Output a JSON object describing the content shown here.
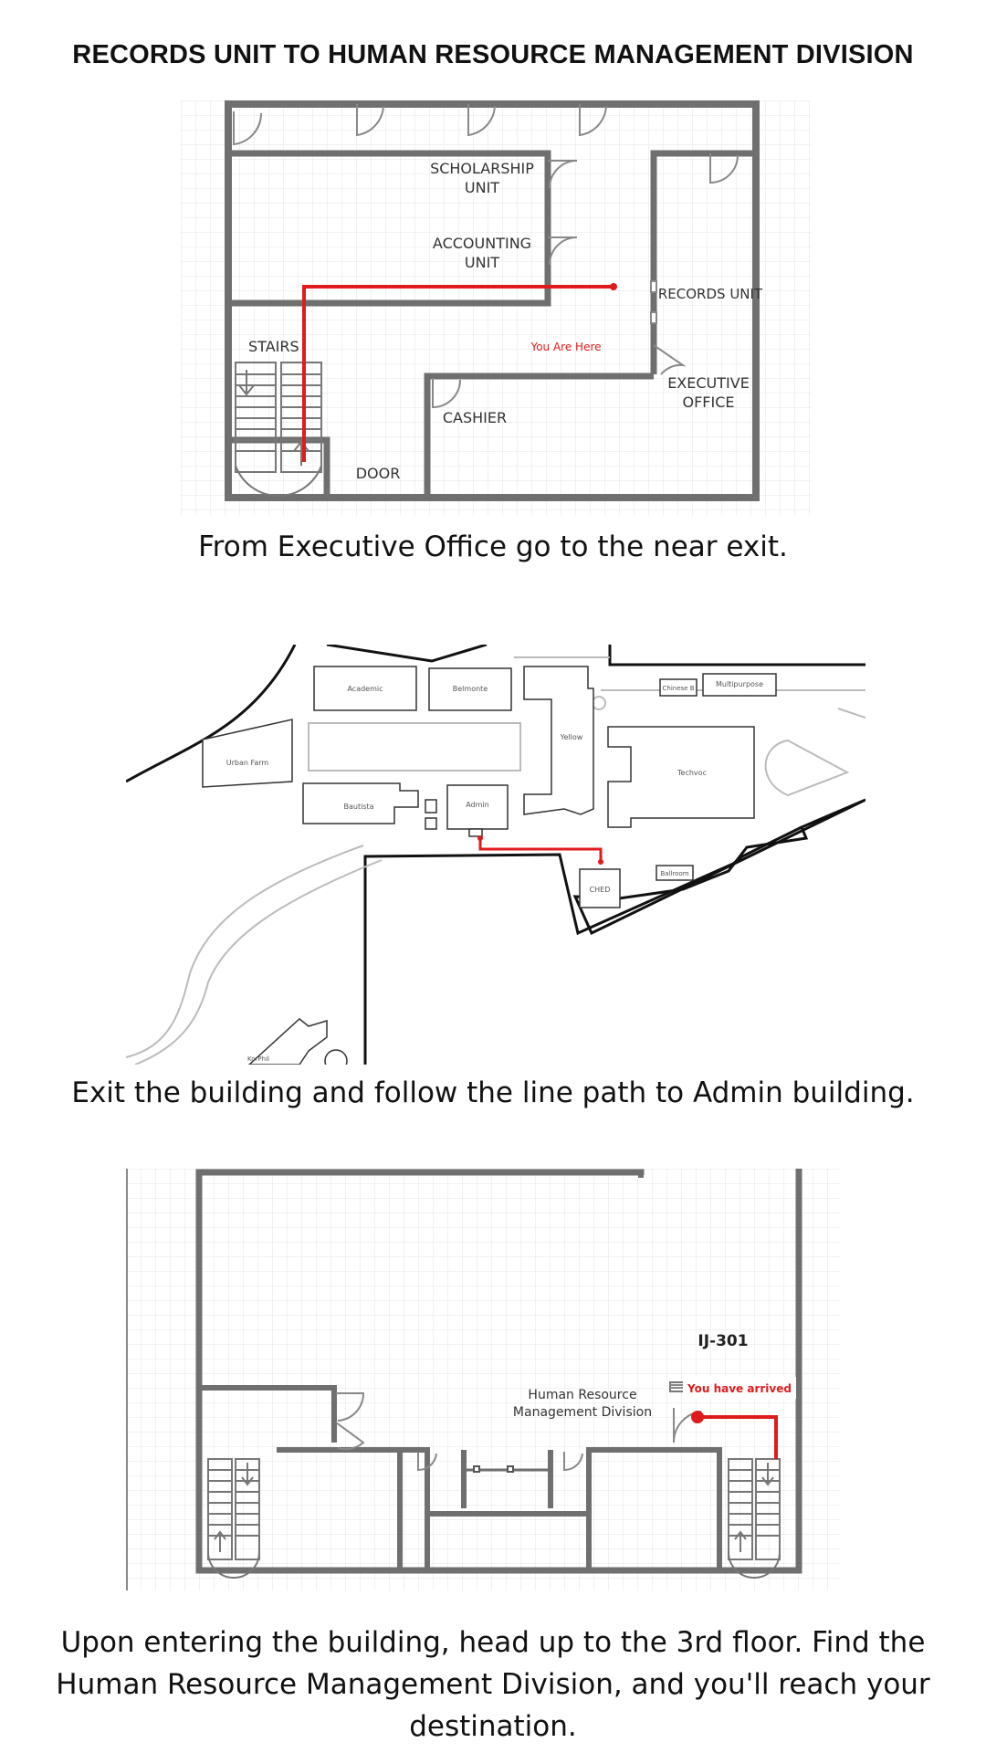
{
  "title": "RECORDS  UNIT TO  HUMAN RESOURCE MANAGEMENT DIVISION",
  "step1": {
    "caption": "From Executive Office  go to the near exit.",
    "labels": {
      "scholarship_1": "SCHOLARSHIP",
      "scholarship_2": "UNIT",
      "accounting_1": "ACCOUNTING",
      "accounting_2": "UNIT",
      "records": "RECORDS UNIT",
      "stairs": "STAIRS",
      "you_are_here": "You Are Here",
      "executive_1": "EXECUTIVE",
      "executive_2": "OFFICE",
      "cashier": "CASHIER",
      "door": "DOOR"
    }
  },
  "step2": {
    "caption": "Exit the building and follow the line path to Admin building.",
    "buildings": {
      "academic": "Academic",
      "belmonte": "Belmonte",
      "yellow": "Yellow",
      "chinese": "Chinese B",
      "multipurpose": "Multipurpose",
      "urban_farm": "Urban Farm",
      "techvoc": "Techvoc",
      "bautista": "Bautista",
      "admin": "Admin",
      "ched": "CHED",
      "ballroom": "Ballroom",
      "korphil": "KorPhil"
    }
  },
  "step3": {
    "caption": "Upon entering the building, head up to the 3rd floor. Find the Human Resource Management Division, and you'll reach your destination.",
    "labels": {
      "room": "IJ-301",
      "hr_1": "Human Resource",
      "hr_2": "Management Division",
      "arrived": "You have arrived"
    }
  },
  "colors": {
    "wall": "#6f6f6f",
    "path": "#e01b1b",
    "grid": "#e6e6e6"
  }
}
